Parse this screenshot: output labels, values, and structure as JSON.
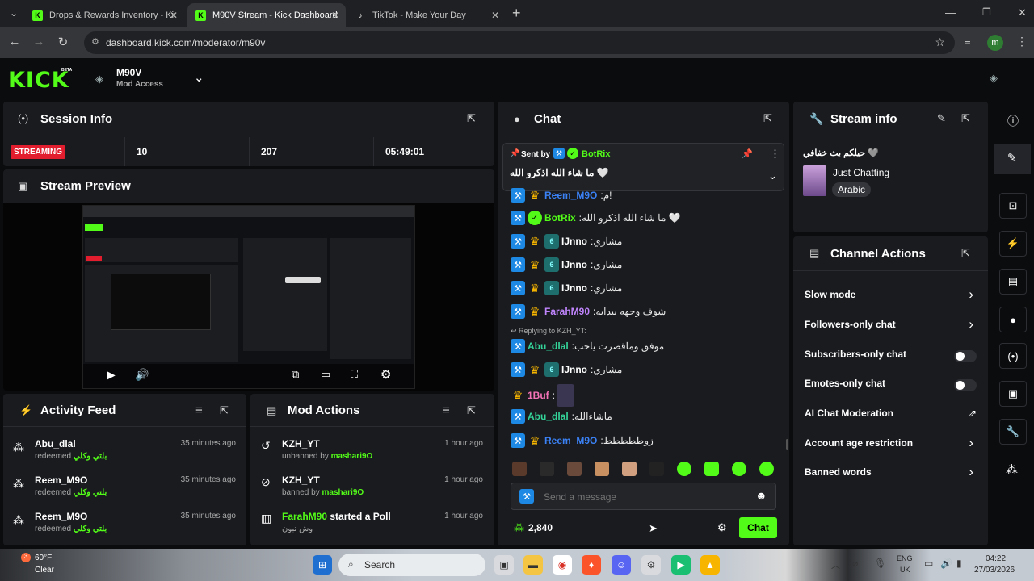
{
  "browser": {
    "tabs": [
      {
        "title": "Drops & Rewards Inventory - Ki",
        "active": false
      },
      {
        "title": "M90V Stream - Kick Dashboard",
        "active": true
      },
      {
        "title": "TikTok - Make Your Day",
        "active": false
      }
    ],
    "url": "dashboard.kick.com/moderator/m90v",
    "profile_initial": "m"
  },
  "header": {
    "logo": "KICK",
    "logo_badge": "BETA",
    "channel_name": "M90V",
    "channel_role": "Mod Access"
  },
  "session_info": {
    "title": "Session Info",
    "status": "STREAMING",
    "viewers": "10",
    "followers": "207",
    "duration": "05:49:01"
  },
  "stream_preview": {
    "title": "Stream Preview"
  },
  "activity_feed": {
    "title": "Activity Feed",
    "items": [
      {
        "user": "Abu_dlal",
        "action": "redeemed",
        "reward": "بلتي وكلي",
        "time": "35 minutes ago"
      },
      {
        "user": "Reem_M9O",
        "action": "redeemed",
        "reward": "بلتي وكلي",
        "time": "35 minutes ago"
      },
      {
        "user": "Reem_M9O",
        "action": "redeemed",
        "reward": "بلتي وكلي",
        "time": "35 minutes ago"
      }
    ]
  },
  "mod_actions": {
    "title": "Mod Actions",
    "items": [
      {
        "user": "KZH_YT",
        "action": "unbanned by",
        "by": "mashari9O",
        "time": "1 hour ago"
      },
      {
        "user": "KZH_YT",
        "action": "banned by",
        "by": "mashari9O",
        "time": "1 hour ago"
      },
      {
        "user": "FarahM90",
        "action": "started a Poll",
        "by": "وش تبون",
        "time": "1 hour ago"
      }
    ]
  },
  "chat": {
    "title": "Chat",
    "pinned": {
      "label": "Sent by",
      "user": "BotRix",
      "text": "ما شاء الله اذكرو الله 🤍"
    },
    "messages": [
      {
        "user": "Reem_M9O",
        "color": "#3b82f6",
        "text": "م!",
        "badges": [
          "mod",
          "crown"
        ]
      },
      {
        "user": "BotRix",
        "color": "#53fc18",
        "text": "ما شاء الله اذكرو الله 🤍",
        "badges": [
          "mod",
          "verified"
        ]
      },
      {
        "user": "IJnno",
        "color": "#ffffff",
        "text": "مشاري",
        "badges": [
          "mod",
          "crown",
          "sub"
        ]
      },
      {
        "user": "IJnno",
        "color": "#ffffff",
        "text": "مشاري",
        "badges": [
          "mod",
          "crown",
          "sub"
        ]
      },
      {
        "user": "IJnno",
        "color": "#ffffff",
        "text": "مشاري",
        "badges": [
          "mod",
          "crown",
          "sub"
        ]
      },
      {
        "user": "FarahM90",
        "color": "#c084fc",
        "text": "شوف وجهه بيدايه",
        "badges": [
          "mod",
          "crown"
        ]
      },
      {
        "user": "Abu_dlal",
        "color": "#34d399",
        "text": "موفق وماقصرت ياحب",
        "badges": [
          "mod"
        ],
        "reply": "Replying to KZH_YT:"
      },
      {
        "user": "IJnno",
        "color": "#ffffff",
        "text": "مشاري",
        "badges": [
          "mod",
          "crown",
          "sub"
        ]
      },
      {
        "user": "1Buf",
        "color": "#f472b6",
        "text": "",
        "badges": [
          "crown"
        ]
      },
      {
        "user": "Abu_dlal",
        "color": "#34d399",
        "text": "ماشاءالله",
        "badges": [
          "mod"
        ]
      },
      {
        "user": "Reem_M9O",
        "color": "#3b82f6",
        "text": "زوططططط",
        "badges": [
          "mod",
          "crown"
        ]
      }
    ],
    "input_placeholder": "Send a message",
    "points": "2,840",
    "send_label": "Chat"
  },
  "stream_info": {
    "title": "Stream info",
    "stream_title": "حيلكم بث خفافي 🩶",
    "category": "Just Chatting",
    "tag": "Arabic"
  },
  "channel_actions": {
    "title": "Channel Actions",
    "items": [
      {
        "label": "Slow mode",
        "control": "chevron"
      },
      {
        "label": "Followers-only chat",
        "control": "chevron"
      },
      {
        "label": "Subscribers-only chat",
        "control": "toggle"
      },
      {
        "label": "Emotes-only chat",
        "control": "toggle"
      },
      {
        "label": "AI Chat Moderation",
        "control": "external"
      },
      {
        "label": "Account age restriction",
        "control": "chevron"
      },
      {
        "label": "Banned words",
        "control": "chevron"
      }
    ]
  },
  "taskbar": {
    "weather_temp": "60°F",
    "weather_text": "Clear",
    "search_label": "Search",
    "lang_top": "ENG",
    "lang_bottom": "UK",
    "time": "04:22",
    "date": "27/03/2026"
  },
  "colors": {
    "kick_green": "#53fc18",
    "live_red": "#e11d2e",
    "panel_bg": "#191b1f"
  }
}
